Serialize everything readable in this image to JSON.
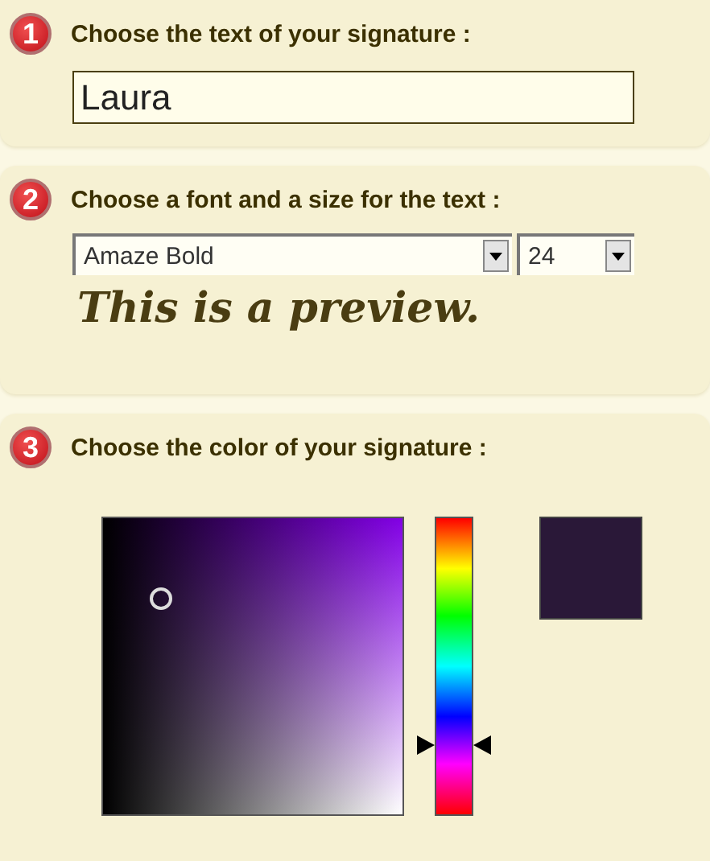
{
  "steps": [
    {
      "number": "1",
      "title": "Choose the text of your signature :",
      "kind": "text",
      "value": "Laura"
    },
    {
      "number": "2",
      "title": "Choose a font and a size for the text :",
      "kind": "font",
      "font": "Amaze Bold",
      "size": "24",
      "preview": "This is a preview."
    },
    {
      "number": "3",
      "title": "Choose the color of your signature :",
      "kind": "color",
      "swatch": {
        "color": "#2a1838"
      }
    }
  ]
}
